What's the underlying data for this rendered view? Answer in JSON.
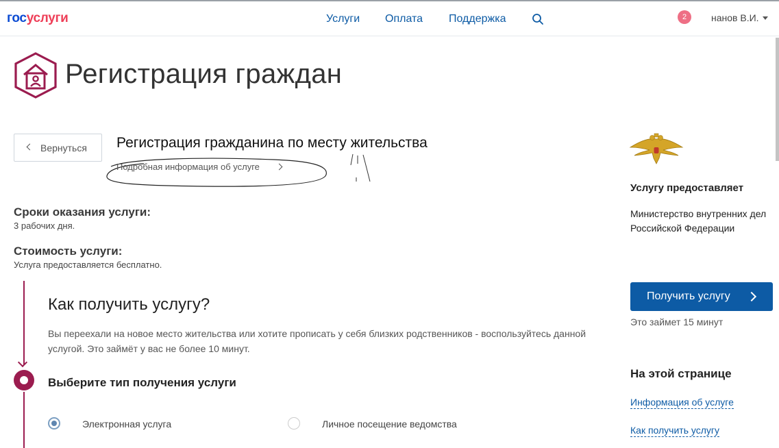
{
  "header": {
    "logo_part1": "гос",
    "logo_part2": "услуги",
    "nav": [
      "Услуги",
      "Оплата",
      "Поддержка"
    ],
    "notifications": "2",
    "user": "нанов В.И."
  },
  "hero": {
    "title": "Регистрация граждан"
  },
  "service": {
    "back_label": "Вернуться",
    "title": "Регистрация гражданина по месту жительства",
    "more_info": "Подробная информация об услуге",
    "terms_label": "Сроки оказания услуги:",
    "terms_value": "3 рабочих дня.",
    "cost_label": "Стоимость услуги:",
    "cost_value": "Услуга предоставляется бесплатно."
  },
  "how": {
    "title": "Как получить услугу?",
    "description": "Вы переехали на новое место жительства или хотите прописать у себя близких родственников - воспользуйтесь данной услугой. Это займёт у вас не более 10 минут.",
    "choose_title": "Выберите тип получения услуги",
    "options": [
      {
        "label": "Электронная услуга",
        "selected": true
      },
      {
        "label": "Личное посещение ведомства",
        "selected": false
      }
    ]
  },
  "sidebar": {
    "provider_label": "Услугу предоставляет",
    "provider_name": "Министерство внутренних дел Российской Федерации",
    "get_button": "Получить услугу",
    "time_note": "Это займет 15 минут",
    "on_page_title": "На этой странице",
    "links": [
      "Информация об услуге",
      "Как получить услугу"
    ]
  },
  "colors": {
    "brand_blue": "#0d5ba5",
    "accent_red": "#ee3f58",
    "step_accent": "#9b1c4f"
  },
  "icons": [
    "search-icon",
    "house-person-icon",
    "chevron-left-icon",
    "chevron-right-icon",
    "double-headed-eagle-emblem"
  ]
}
